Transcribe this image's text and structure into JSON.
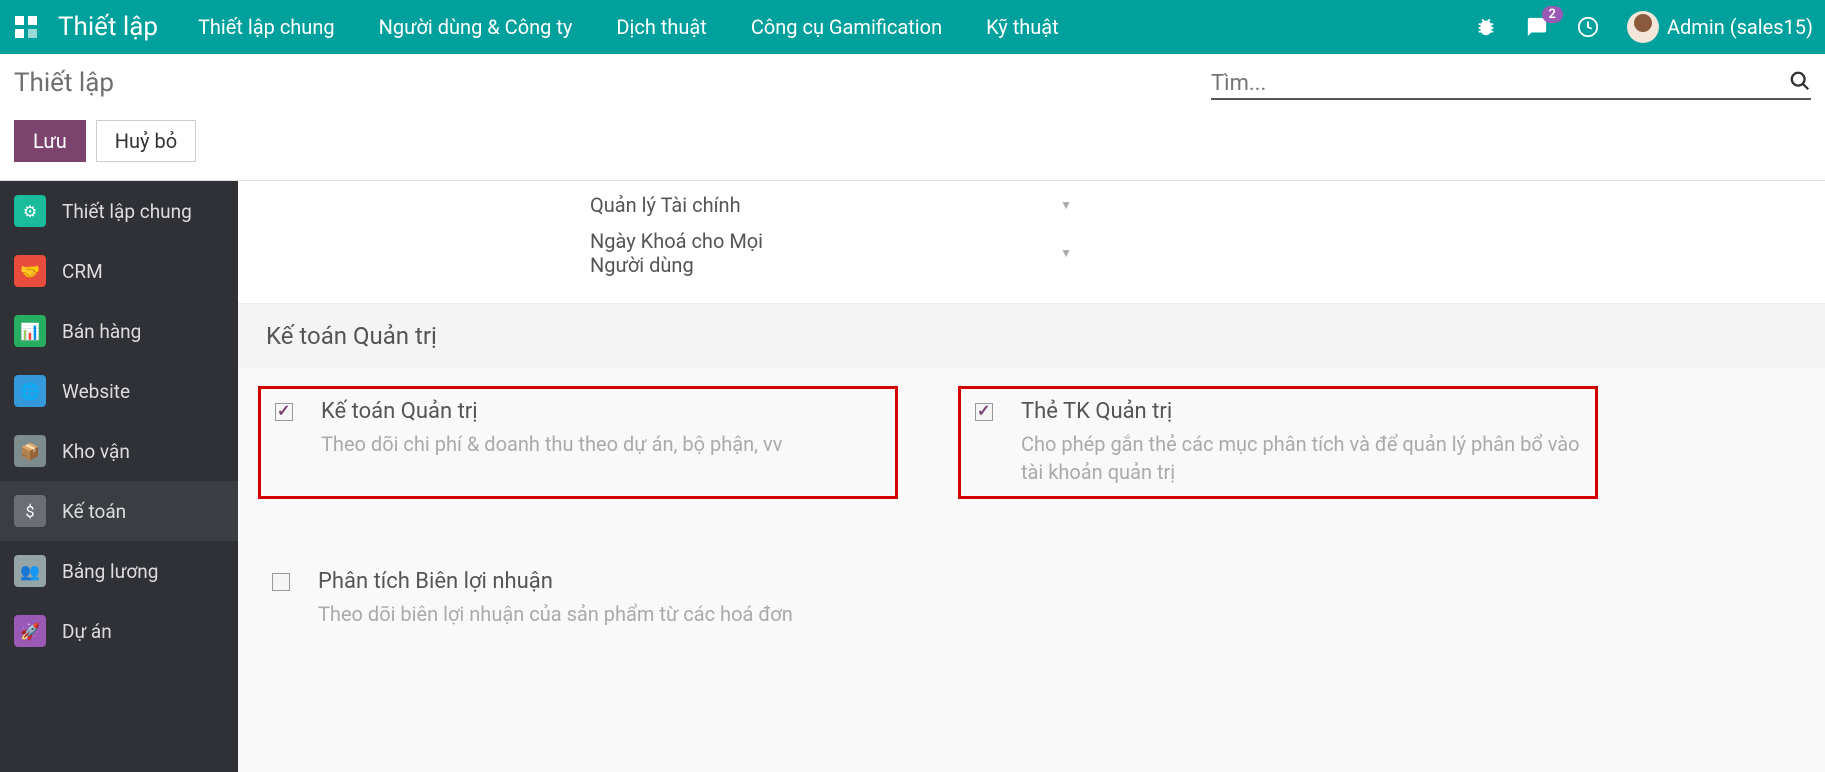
{
  "topbar": {
    "brand": "Thiết lập",
    "menu": [
      "Thiết lập chung",
      "Người dùng & Công ty",
      "Dịch thuật",
      "Công cụ Gamification",
      "Kỹ thuật"
    ],
    "badge_count": "2",
    "user": "Admin (sales15)"
  },
  "subheader": {
    "breadcrumb": "Thiết lập",
    "search_placeholder": "Tìm...",
    "save": "Lưu",
    "discard": "Huỷ bỏ"
  },
  "sidebar": {
    "items": [
      {
        "label": "Thiết lập chung",
        "color": "#1abc9c"
      },
      {
        "label": "CRM",
        "color": "#e74c3c"
      },
      {
        "label": "Bán hàng",
        "color": "#27ae60"
      },
      {
        "label": "Website",
        "color": "#3498db"
      },
      {
        "label": "Kho vận",
        "color": "#7f8c8d"
      },
      {
        "label": "Kế toán",
        "color": "#6b6f75"
      },
      {
        "label": "Bảng lương",
        "color": "#95a5a6"
      },
      {
        "label": "Dự án",
        "color": "#9b59b6"
      }
    ],
    "active_index": 5
  },
  "content": {
    "fields": [
      {
        "label": "Quản lý Tài chính"
      },
      {
        "label": "Ngày Khoá cho Mọi Người dùng"
      }
    ],
    "section_title": "Kế toán Quản trị",
    "settings": [
      {
        "checked": true,
        "highlight": true,
        "title": "Kế toán Quản trị",
        "desc": "Theo dõi chi phí & doanh thu theo dự án, bộ phận, vv"
      },
      {
        "checked": true,
        "highlight": true,
        "title": "Thẻ TK Quản trị",
        "desc": "Cho phép gắn thẻ các mục phân tích và để quản lý phân bổ vào tài khoản quản trị"
      },
      {
        "checked": false,
        "highlight": false,
        "title": "Phân tích Biên lợi nhuận",
        "desc": "Theo dõi biên lợi nhuận của sản phẩm từ các hoá đơn"
      }
    ]
  }
}
